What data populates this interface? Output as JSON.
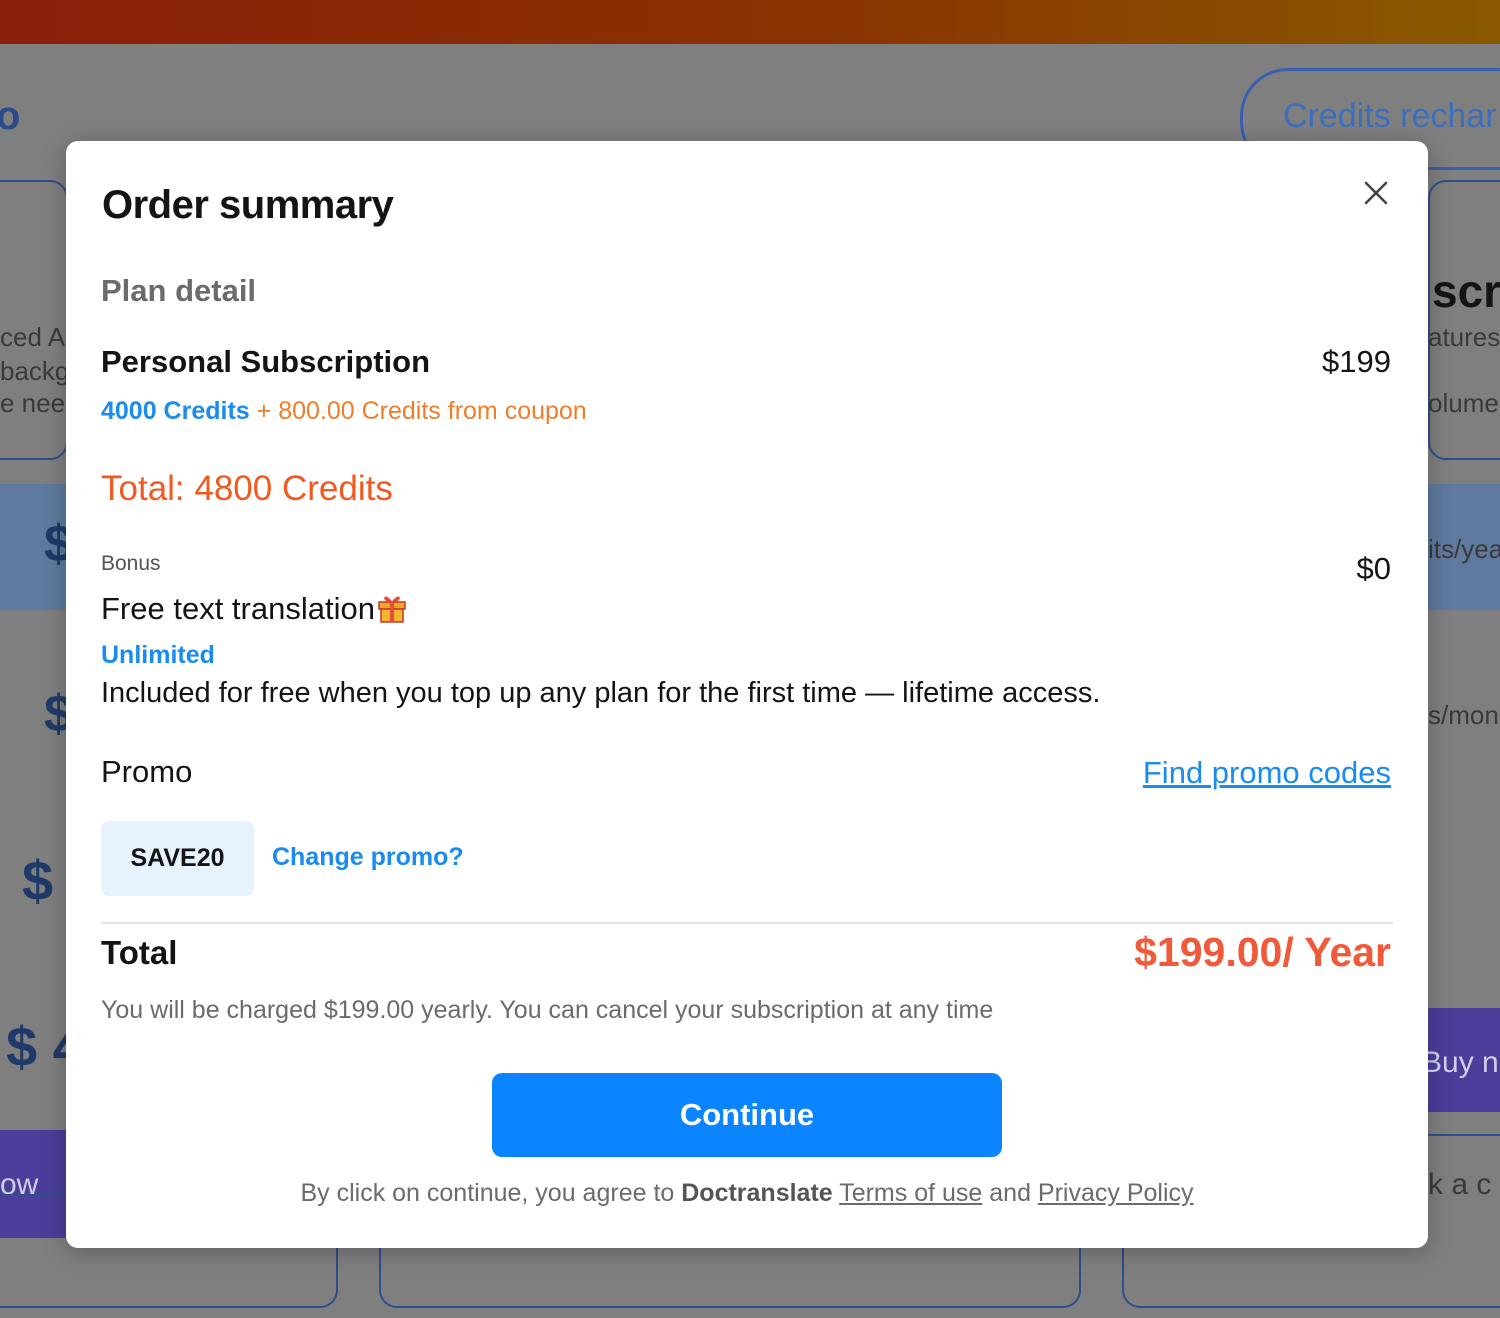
{
  "background": {
    "credits_button": "Credits rechar",
    "left_fragments": [
      "o",
      "ced AI",
      "backg",
      "e need",
      "$",
      "$",
      "$",
      "$ 4",
      "ow"
    ],
    "right_fragments": [
      "scr",
      "atures,",
      "olume",
      "its/yea",
      "s/mon",
      "Buy no",
      "k a c"
    ]
  },
  "modal": {
    "title": "Order summary",
    "close_icon": "close-icon",
    "plan_detail_label": "Plan detail",
    "plan": {
      "name": "Personal Subscription",
      "price": "$199",
      "credits": "4000 Credits",
      "plus": " + ",
      "coupon_credits": "800.00 Credits from coupon",
      "total_credits": "Total: 4800 Credits"
    },
    "bonus": {
      "label": "Bonus",
      "price": "$0",
      "name": "Free text translation",
      "icon": "gift-icon",
      "unlimited": "Unlimited",
      "description": "Included for free when you top up any plan for the first time — lifetime access."
    },
    "promo": {
      "label": "Promo",
      "find_link": "Find promo codes",
      "code": "SAVE20",
      "change_link": "Change promo?"
    },
    "total": {
      "label": "Total",
      "price": "$199.00/ Year",
      "note": "You will be charged $199.00 yearly. You can cancel your subscription at any time"
    },
    "continue_label": "Continue",
    "agree": {
      "prefix": "By click on continue, you agree to ",
      "brand": "Doctranslate",
      "terms": "Terms of use",
      "and": " and ",
      "privacy": "Privacy Policy"
    }
  },
  "colors": {
    "accent_blue": "#0a84ff",
    "link_blue": "#1a8cf0",
    "orange": "#f05a20",
    "price_red": "#f05a3a"
  }
}
